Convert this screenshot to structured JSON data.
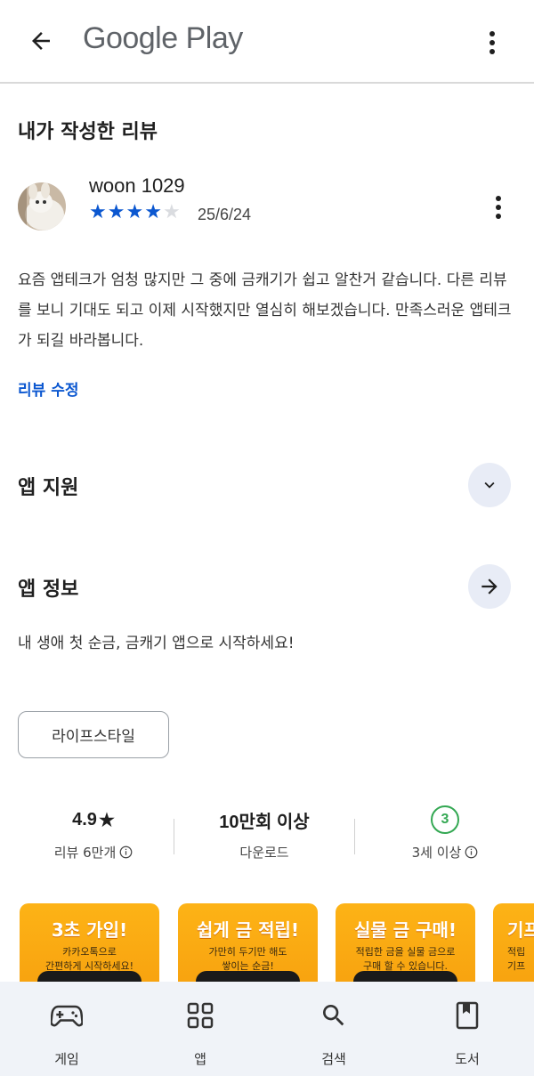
{
  "header": {
    "title": "Google Play",
    "back_icon": "arrow-left-icon",
    "menu_icon": "more-vert-icon"
  },
  "my_review": {
    "section_title": "내가 작성한 리뷰",
    "reviewer_name": "woon 1029",
    "rating": 4,
    "rating_max": 5,
    "date": "25/6/24",
    "body": "요즘 앱테크가 엄청 많지만 그 중에 금캐기가 쉽고 알찬거 같습니다. 다른 리뷰를 보니 기대도 되고 이제 시작했지만 열심히 해보겠습니다. 만족스러운 앱테크가 되길 바라봅니다.",
    "edit_label": "리뷰 수정",
    "star_color": "#0b57d0"
  },
  "app_support": {
    "title": "앱 지원",
    "icon": "chevron-down-icon"
  },
  "app_info": {
    "title": "앱 정보",
    "icon": "arrow-right-icon",
    "description": "내 생애 첫 순금, 금캐기 앱으로 시작하세요!",
    "category_chip": "라이프스타일"
  },
  "stats": {
    "rating_value": "4.9",
    "rating_label": "리뷰 6만개",
    "downloads_value": "10만회 이상",
    "downloads_label": "다운로드",
    "age_value": "3",
    "age_label": "3세 이상",
    "age_color": "#34a853"
  },
  "screenshots": [
    {
      "title": "3초 가입!",
      "sub1": "카카오톡으로",
      "sub2": "간편하게 시작하세요!"
    },
    {
      "title": "쉽게 금 적립!",
      "sub1": "가만히 두기만 해도",
      "sub2": "쌓이는 순금!"
    },
    {
      "title": "실물 금 구매!",
      "sub1": "적립한 금을 실물 금으로",
      "sub2": "구매 할 수 있습니다."
    },
    {
      "title": "기프",
      "sub1": "적립",
      "sub2": "기프"
    }
  ],
  "bottom_nav": [
    {
      "label": "게임",
      "icon": "gamepad-icon"
    },
    {
      "label": "앱",
      "icon": "apps-grid-icon"
    },
    {
      "label": "검색",
      "icon": "search-icon"
    },
    {
      "label": "도서",
      "icon": "book-icon"
    }
  ]
}
